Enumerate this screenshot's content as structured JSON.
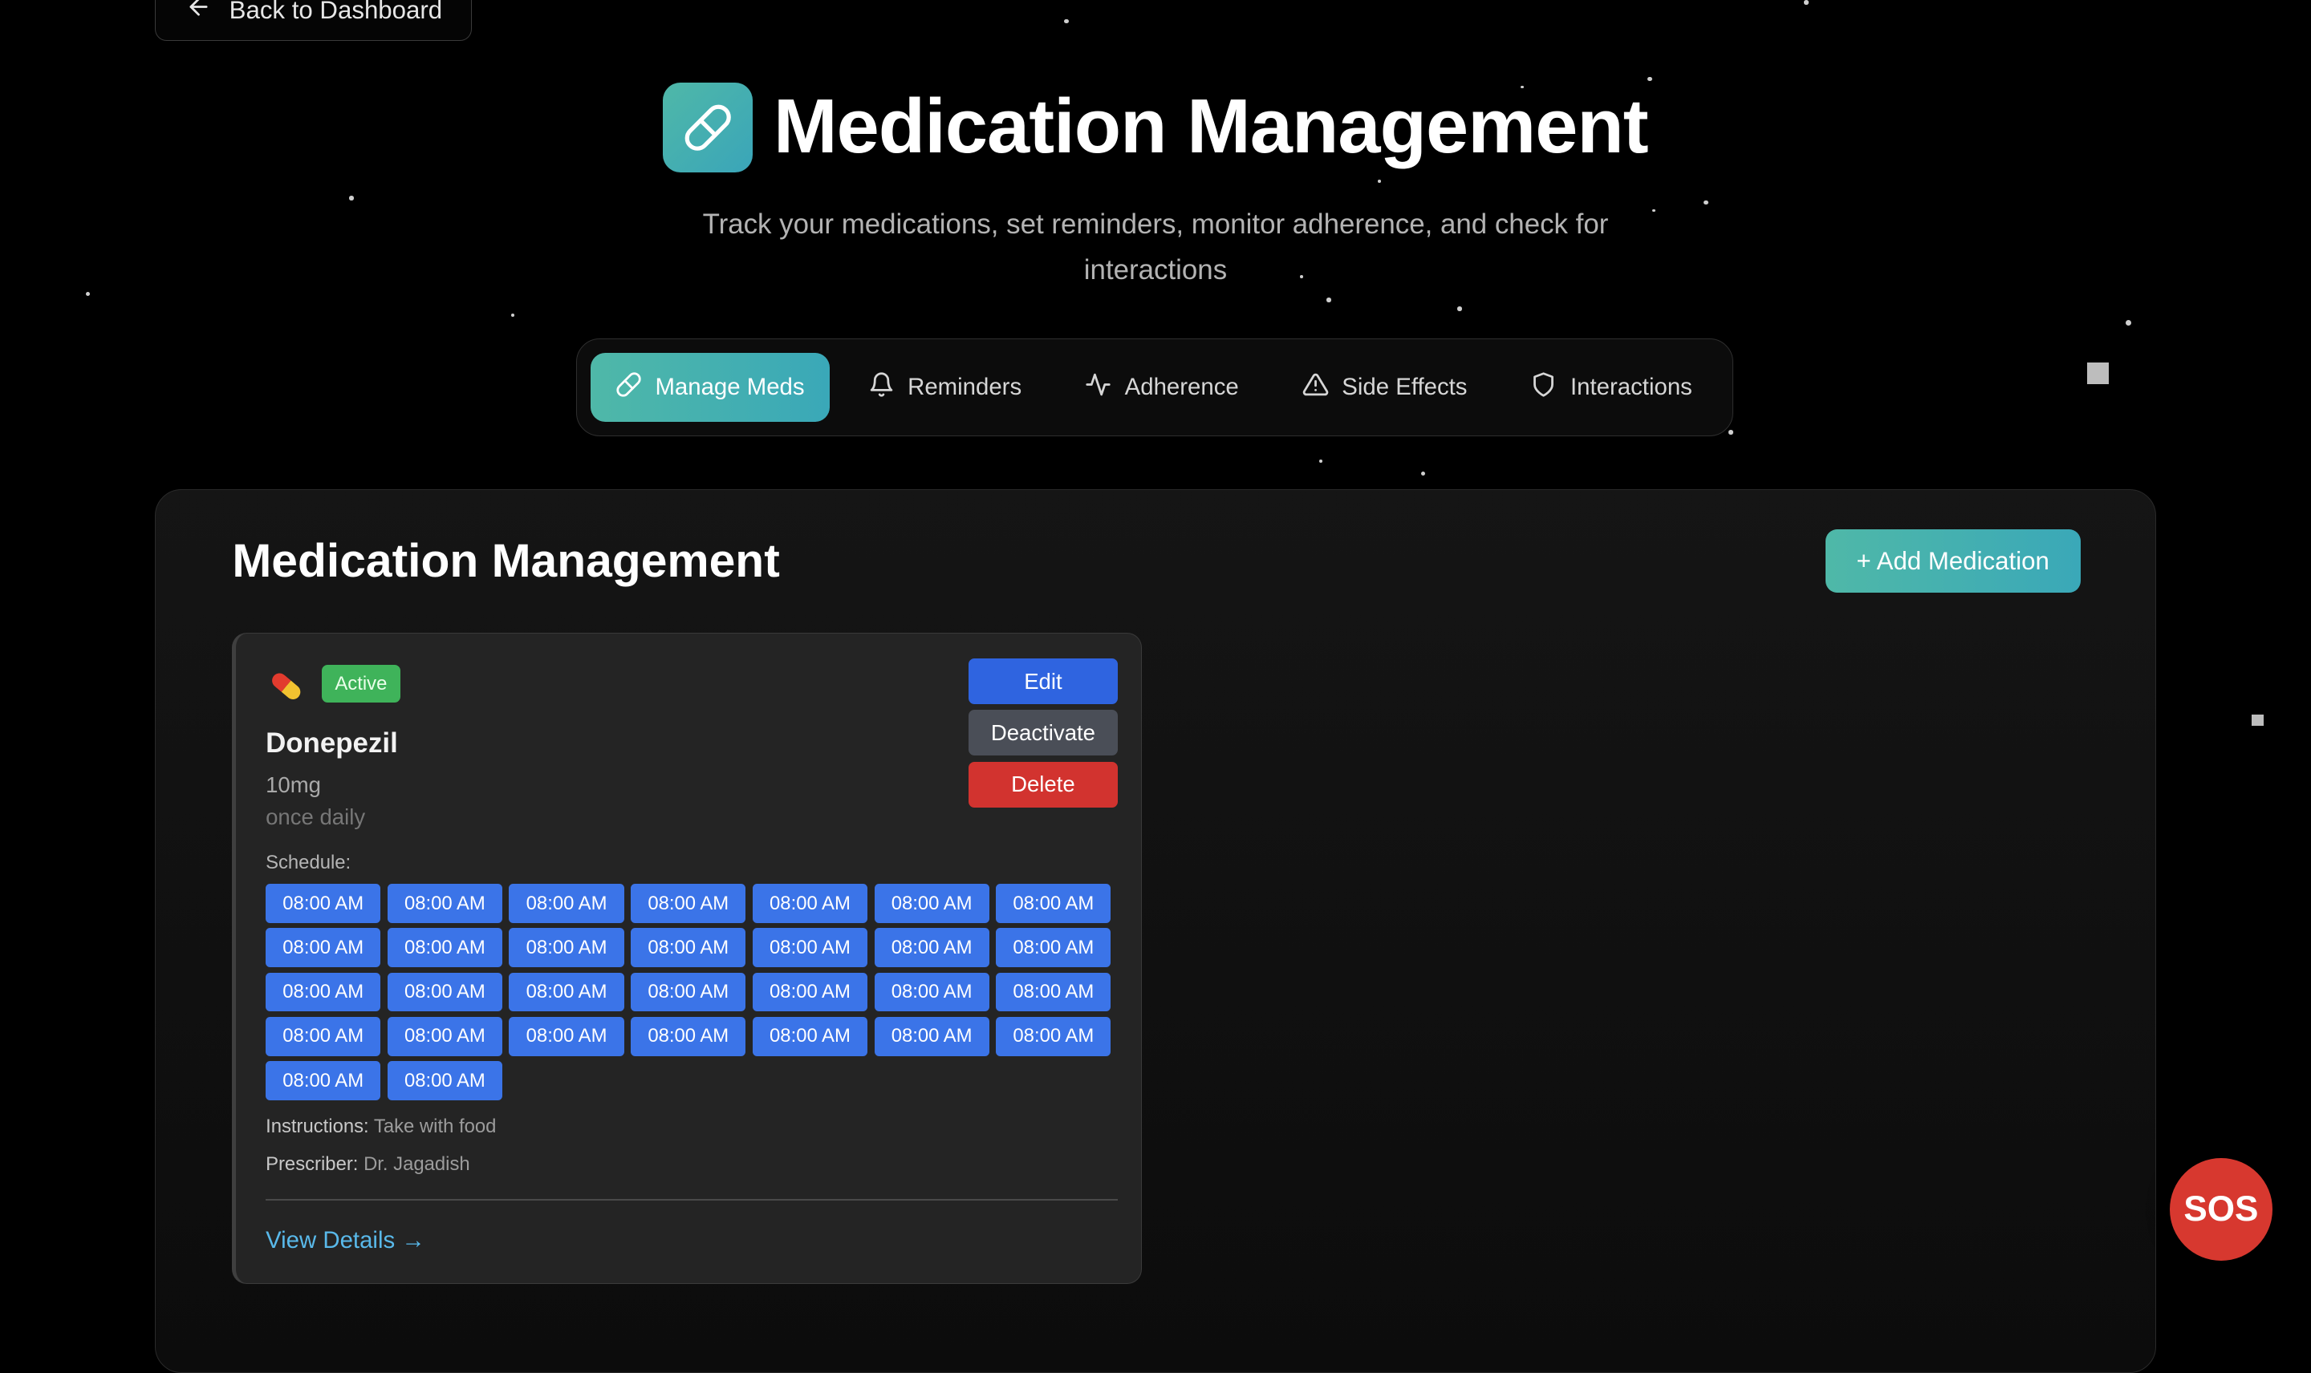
{
  "back_link": {
    "label": "Back to Dashboard",
    "icon": "arrow-left-icon"
  },
  "header": {
    "title": "Medication Management",
    "subtitle": "Track your medications, set reminders, monitor adherence, and check for interactions",
    "icon": "pill-icon"
  },
  "tabs": [
    {
      "label": "Manage Meds",
      "icon": "pill-icon",
      "active": true
    },
    {
      "label": "Reminders",
      "icon": "bell-icon",
      "active": false
    },
    {
      "label": "Adherence",
      "icon": "activity-icon",
      "active": false
    },
    {
      "label": "Side Effects",
      "icon": "warning-icon",
      "active": false
    },
    {
      "label": "Interactions",
      "icon": "shield-icon",
      "active": false
    }
  ],
  "panel": {
    "title": "Medication Management",
    "add_button": "+ Add Medication"
  },
  "medication": {
    "status": "Active",
    "name": "Donepezil",
    "dose": "10mg",
    "frequency": "once daily",
    "actions": {
      "edit": "Edit",
      "deactivate": "Deactivate",
      "delete": "Delete"
    },
    "schedule_label": "Schedule:",
    "schedule": [
      "08:00 AM",
      "08:00 AM",
      "08:00 AM",
      "08:00 AM",
      "08:00 AM",
      "08:00 AM",
      "08:00 AM",
      "08:00 AM",
      "08:00 AM",
      "08:00 AM",
      "08:00 AM",
      "08:00 AM",
      "08:00 AM",
      "08:00 AM",
      "08:00 AM",
      "08:00 AM",
      "08:00 AM",
      "08:00 AM",
      "08:00 AM",
      "08:00 AM",
      "08:00 AM",
      "08:00 AM",
      "08:00 AM",
      "08:00 AM",
      "08:00 AM",
      "08:00 AM",
      "08:00 AM",
      "08:00 AM",
      "08:00 AM",
      "08:00 AM"
    ],
    "instructions_label": "Instructions:",
    "instructions": "Take with food",
    "prescriber_label": "Prescriber:",
    "prescriber": "Dr. Jagadish",
    "view_details": "View Details →"
  },
  "sos": {
    "label": "SOS"
  },
  "colors": {
    "accent": "#4fb8a8",
    "edit": "#2f64e0",
    "deactivate": "#4a4e57",
    "delete": "#d2332f",
    "active_badge": "#3fb35a",
    "time_chip": "#3b74e8",
    "link": "#59b9ea",
    "sos": "#d7382f"
  }
}
